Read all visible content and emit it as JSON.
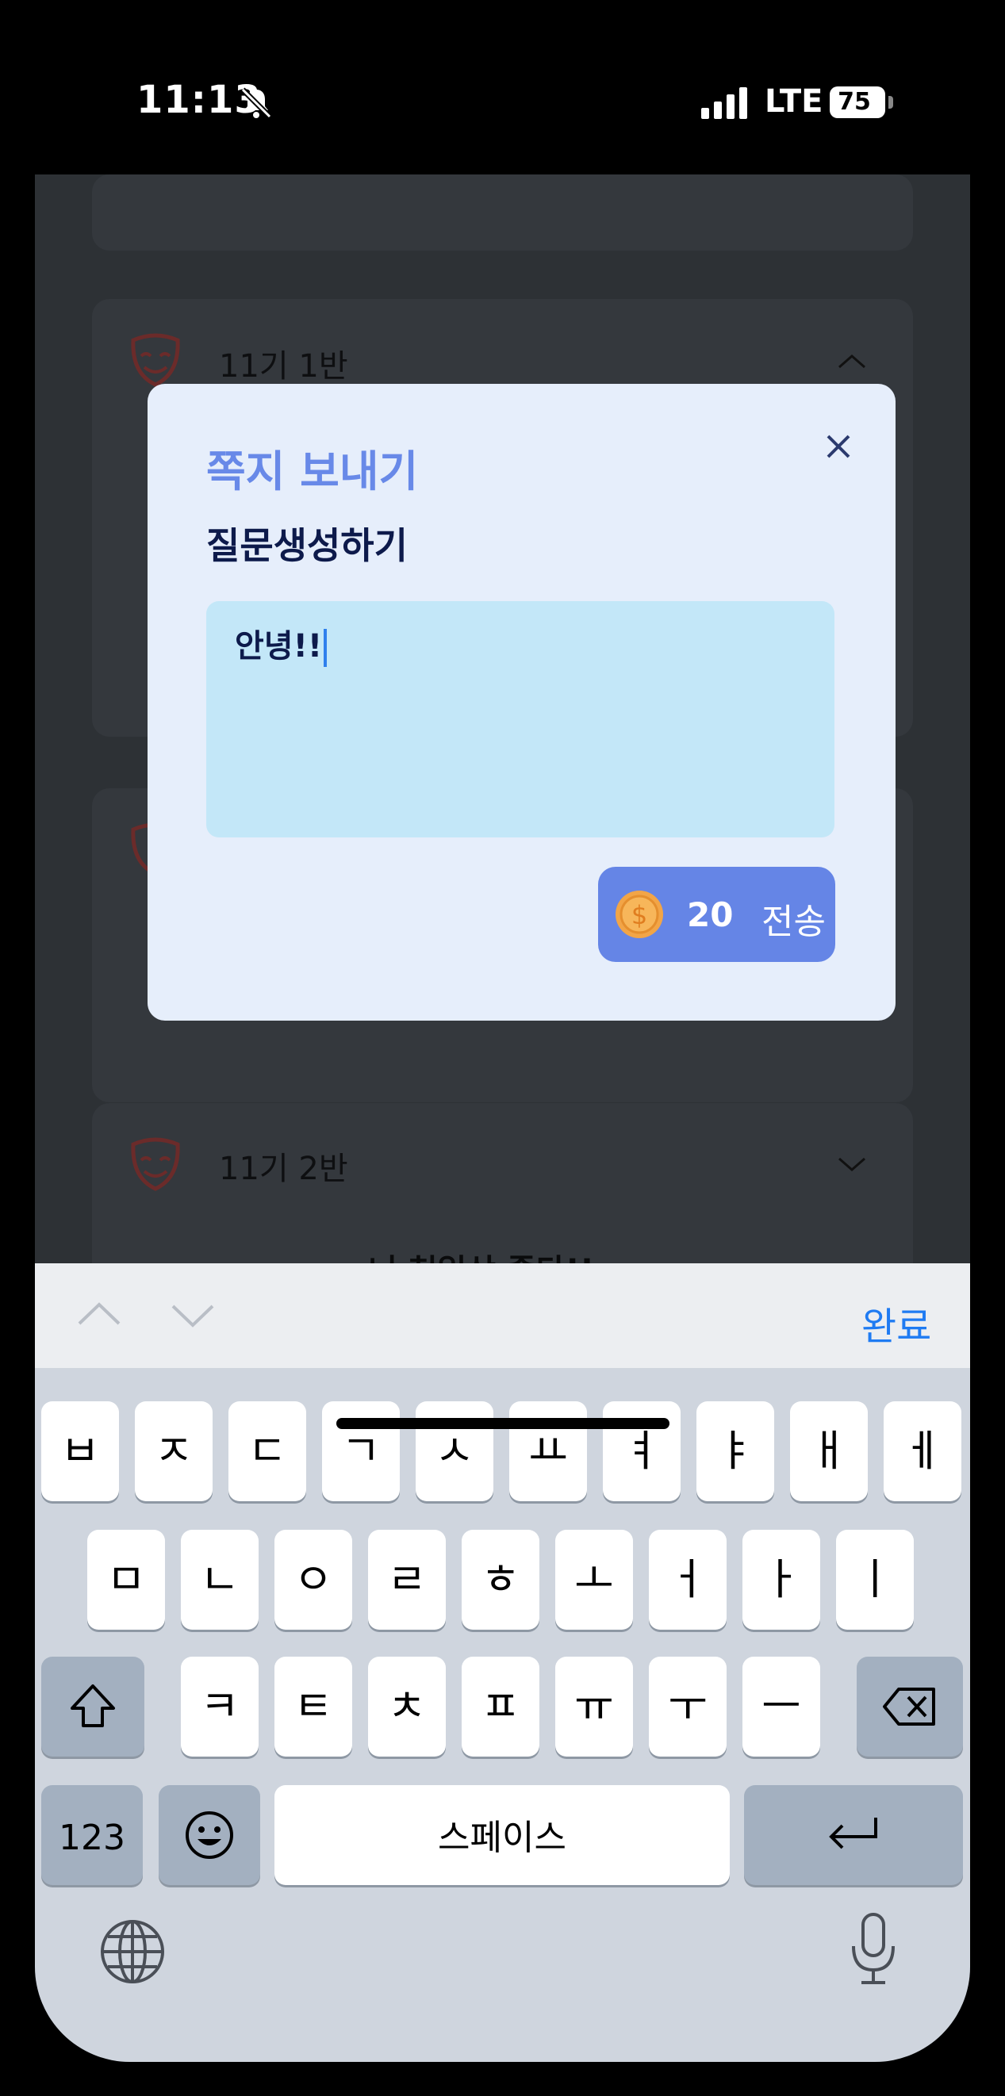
{
  "status_bar": {
    "time": "11:13",
    "network": "LTE",
    "battery": "75"
  },
  "background": {
    "cards": [
      {
        "title": "11기 1반"
      },
      {
        "title": "11기 2반"
      }
    ],
    "partial_text": "너 천일상 좋다!!"
  },
  "modal": {
    "heading": "쪽지 보내기",
    "subtitle": "질문생성하기",
    "message": "안녕!!",
    "cost": "20",
    "send_label": "전송"
  },
  "keyboard": {
    "done_label": "완료",
    "row1": [
      "ㅂ",
      "ㅈ",
      "ㄷ",
      "ㄱ",
      "ㅅ",
      "ㅛ",
      "ㅕ",
      "ㅑ",
      "ㅐ",
      "ㅔ"
    ],
    "row2": [
      "ㅁ",
      "ㄴ",
      "ㅇ",
      "ㄹ",
      "ㅎ",
      "ㅗ",
      "ㅓ",
      "ㅏ",
      "ㅣ"
    ],
    "row3": [
      "ㅋ",
      "ㅌ",
      "ㅊ",
      "ㅍ",
      "ㅠ",
      "ㅜ",
      "ㅡ"
    ],
    "numbers_label": "123",
    "space_label": "스페이스"
  },
  "colors": {
    "accent": "#6585e6",
    "done": "#1f7bf2",
    "message_bg": "#c3e7f8"
  }
}
